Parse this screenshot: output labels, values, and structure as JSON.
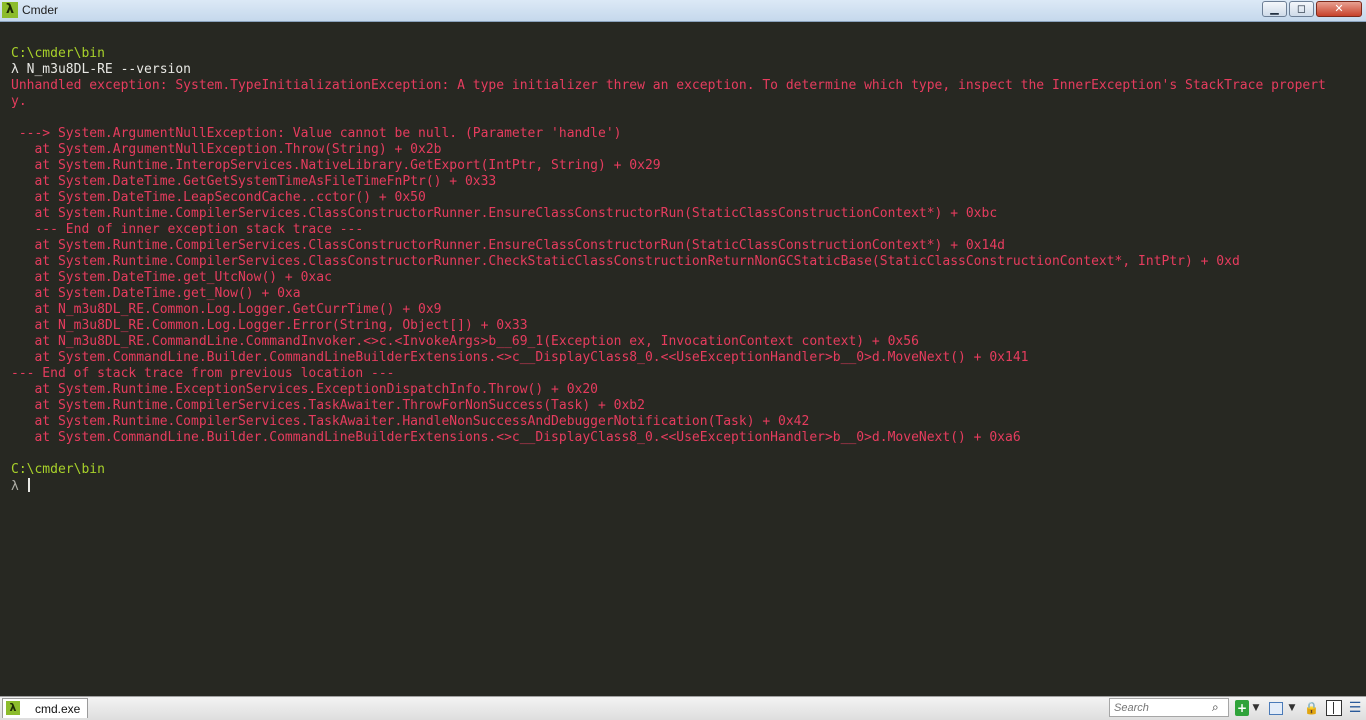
{
  "window": {
    "title": "Cmder",
    "app_icon_glyph": "λ",
    "minimize_glyph": "▁",
    "maximize_glyph": "◻",
    "close_glyph": "✕"
  },
  "console": {
    "lines": [
      {
        "kind": "path",
        "text": "C:\\cmder\\bin"
      },
      {
        "kind": "cmd",
        "text": "λ N_m3u8DL-RE --version"
      },
      {
        "kind": "err",
        "text": "Unhandled exception: System.TypeInitializationException: A type initializer threw an exception. To determine which type, inspect the InnerException's StackTrace propert"
      },
      {
        "kind": "err",
        "text": "y."
      },
      {
        "kind": "blank",
        "text": ""
      },
      {
        "kind": "err",
        "text": " ---> System.ArgumentNullException: Value cannot be null. (Parameter 'handle')"
      },
      {
        "kind": "err",
        "text": "   at System.ArgumentNullException.Throw(String) + 0x2b"
      },
      {
        "kind": "err",
        "text": "   at System.Runtime.InteropServices.NativeLibrary.GetExport(IntPtr, String) + 0x29"
      },
      {
        "kind": "err",
        "text": "   at System.DateTime.GetGetSystemTimeAsFileTimeFnPtr() + 0x33"
      },
      {
        "kind": "err",
        "text": "   at System.DateTime.LeapSecondCache..cctor() + 0x50"
      },
      {
        "kind": "err",
        "text": "   at System.Runtime.CompilerServices.ClassConstructorRunner.EnsureClassConstructorRun(StaticClassConstructionContext*) + 0xbc"
      },
      {
        "kind": "err",
        "text": "   --- End of inner exception stack trace ---"
      },
      {
        "kind": "err",
        "text": "   at System.Runtime.CompilerServices.ClassConstructorRunner.EnsureClassConstructorRun(StaticClassConstructionContext*) + 0x14d"
      },
      {
        "kind": "err",
        "text": "   at System.Runtime.CompilerServices.ClassConstructorRunner.CheckStaticClassConstructionReturnNonGCStaticBase(StaticClassConstructionContext*, IntPtr) + 0xd"
      },
      {
        "kind": "err",
        "text": "   at System.DateTime.get_UtcNow() + 0xac"
      },
      {
        "kind": "err",
        "text": "   at System.DateTime.get_Now() + 0xa"
      },
      {
        "kind": "err",
        "text": "   at N_m3u8DL_RE.Common.Log.Logger.GetCurrTime() + 0x9"
      },
      {
        "kind": "err",
        "text": "   at N_m3u8DL_RE.Common.Log.Logger.Error(String, Object[]) + 0x33"
      },
      {
        "kind": "err",
        "text": "   at N_m3u8DL_RE.CommandLine.CommandInvoker.<>c.<InvokeArgs>b__69_1(Exception ex, InvocationContext context) + 0x56"
      },
      {
        "kind": "err",
        "text": "   at System.CommandLine.Builder.CommandLineBuilderExtensions.<>c__DisplayClass8_0.<<UseExceptionHandler>b__0>d.MoveNext() + 0x141"
      },
      {
        "kind": "err",
        "text": "--- End of stack trace from previous location ---"
      },
      {
        "kind": "err",
        "text": "   at System.Runtime.ExceptionServices.ExceptionDispatchInfo.Throw() + 0x20"
      },
      {
        "kind": "err",
        "text": "   at System.Runtime.CompilerServices.TaskAwaiter.ThrowForNonSuccess(Task) + 0xb2"
      },
      {
        "kind": "err",
        "text": "   at System.Runtime.CompilerServices.TaskAwaiter.HandleNonSuccessAndDebuggerNotification(Task) + 0x42"
      },
      {
        "kind": "err",
        "text": "   at System.CommandLine.Builder.CommandLineBuilderExtensions.<>c__DisplayClass8_0.<<UseExceptionHandler>b__0>d.MoveNext() + 0xa6"
      },
      {
        "kind": "blank",
        "text": ""
      },
      {
        "kind": "path",
        "text": "C:\\cmder\\bin"
      }
    ],
    "prompt_glyph": "λ "
  },
  "bottombar": {
    "tab_label": "cmd.exe",
    "tab_icon_glyph": "λ",
    "search_placeholder": "Search",
    "search_icon_glyph": "⌕",
    "add_glyph": "+",
    "dropdown_glyph": "▼",
    "lock_glyph": "🔒",
    "menu_glyph": "☰"
  },
  "colors": {
    "background": "#272822",
    "path": "#a8d12a",
    "error": "#e63c5e",
    "command": "#e8e8e4",
    "accent": "#8cbc2c"
  }
}
